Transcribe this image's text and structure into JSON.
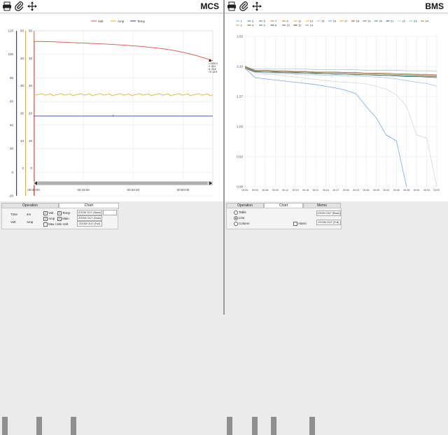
{
  "mcs": {
    "title": "MCS",
    "chart": {
      "legend": [
        {
          "name": "Volt",
          "color": "#d9534f"
        },
        {
          "name": "Amp",
          "color": "#e6b422"
        },
        {
          "name": "Temp",
          "color": "#3a3aa8"
        }
      ],
      "axis_volt": [
        "120",
        "100",
        "80",
        "60",
        "40",
        "20",
        "0",
        "-20"
      ],
      "axis_amp": [
        "50",
        "40",
        "30",
        "20",
        "10",
        "0"
      ],
      "axis_temp": [
        "50",
        "40",
        "30",
        "20",
        "10",
        "0"
      ],
      "x_ticks": [
        "00:00:00",
        "00:16:40",
        "00:33:20",
        "00:50:00"
      ],
      "tooltip": [
        "1:0:0/0:0",
        "V: 93.0",
        "A: 23.8",
        "T0: 18.9"
      ],
      "series": {
        "volt": [
          [
            0,
            111
          ],
          [
            300,
            110.8
          ],
          [
            600,
            110.3
          ],
          [
            900,
            109.7
          ],
          [
            1200,
            109.2
          ],
          [
            1500,
            108.6
          ],
          [
            1800,
            107.9
          ],
          [
            2100,
            107
          ],
          [
            2400,
            105.7
          ],
          [
            2700,
            104.2
          ],
          [
            3000,
            101.8
          ],
          [
            3300,
            98.6
          ],
          [
            3600,
            94.6
          ]
        ],
        "amp": [
          [
            0,
            26.8
          ],
          [
            3600,
            26.8
          ]
        ],
        "temp": [
          [
            0,
            19
          ],
          [
            3600,
            19
          ]
        ]
      }
    },
    "tabs": [
      "Operation",
      "Chart"
    ],
    "controls": {
      "time_label": "Time",
      "time_value": "4m",
      "volt_label": "Volt",
      "amp_label": "Amp",
      "cb_volt": "Volt",
      "cb_amp": "Amp",
      "cb_minmax": "Max / Min Volt",
      "cb_temp": "Temp",
      "cb_main": "Main",
      "btn_zoom_back": "ZOOM OUT (Back)",
      "btn_zoom_data": "ZOOM OUT (Data)",
      "btn_zoom_full": "ZOOM OUT (Full)"
    }
  },
  "bms": {
    "title": "BMS",
    "chart": {
      "y_ticks": [
        "2.62",
        "2.10",
        "1.57",
        "1.05",
        "0.52",
        "0.00"
      ],
      "x_ticks": [
        "00:00",
        "00:03",
        "00:06",
        "00:09",
        "00:12",
        "00:15",
        "00:18",
        "00:21",
        "00:24",
        "00:27",
        "00:30",
        "00:33",
        "00:36",
        "00:39",
        "00:42",
        "00:45",
        "00:48",
        "00:51",
        "00:54",
        "00:57"
      ],
      "legend": [
        {
          "name": "1",
          "color": "#7fb3d5"
        },
        {
          "name": "2",
          "color": "#e59866"
        },
        {
          "name": "3",
          "color": "#2e86c1"
        },
        {
          "name": "4",
          "color": "#a04000"
        },
        {
          "name": "5",
          "color": "#5d6d7e"
        },
        {
          "name": "6",
          "color": "#138d75"
        },
        {
          "name": "7",
          "color": "#ca6f1e"
        },
        {
          "name": "8",
          "color": "#1b4f72"
        },
        {
          "name": "9",
          "color": "#b9770e"
        },
        {
          "name": "10",
          "color": "#7d3c98"
        },
        {
          "name": "11",
          "color": "#d4ac0d"
        },
        {
          "name": "12",
          "color": "#6e2c00"
        },
        {
          "name": "13",
          "color": "#f1c40f"
        },
        {
          "name": "14",
          "color": "#85929e"
        },
        {
          "name": "15",
          "color": "#aab7b8"
        },
        {
          "name": "16",
          "color": "#5dade2"
        },
        {
          "name": "17",
          "color": "#f39c12"
        },
        {
          "name": "18",
          "color": "#c0392b"
        },
        {
          "name": "19",
          "color": "#566573"
        },
        {
          "name": "20",
          "color": "#229954"
        },
        {
          "name": "21",
          "color": "#1f618d"
        },
        {
          "name": "22",
          "color": "#a3e4d7"
        },
        {
          "name": "23",
          "color": "#76d7c4"
        },
        {
          "name": "24",
          "color": "#dc7633"
        }
      ],
      "cells": [
        {
          "color": "#9fc5e8",
          "v": [
            [
              0,
              2.07
            ],
            [
              3,
              2.0
            ],
            [
              6,
              1.98
            ],
            [
              9,
              1.97
            ],
            [
              12,
              1.97
            ],
            [
              15,
              1.96
            ],
            [
              18,
              1.95
            ],
            [
              21,
              1.95
            ],
            [
              24,
              1.94
            ],
            [
              27,
              1.94
            ],
            [
              30,
              1.93
            ],
            [
              33,
              1.93
            ],
            [
              36,
              1.92
            ],
            [
              39,
              1.91
            ],
            [
              42,
              1.9
            ],
            [
              45,
              1.88
            ],
            [
              48,
              1.85
            ],
            [
              51,
              1.82
            ],
            [
              54,
              1.8
            ],
            [
              57,
              1.75
            ]
          ]
        },
        {
          "color": "#7fa9d6",
          "v": [
            [
              0,
              2.07
            ],
            [
              3,
              1.9
            ],
            [
              6,
              1.88
            ],
            [
              9,
              1.86
            ],
            [
              12,
              1.84
            ],
            [
              15,
              1.82
            ],
            [
              18,
              1.8
            ],
            [
              21,
              1.78
            ],
            [
              24,
              1.75
            ],
            [
              27,
              1.72
            ],
            [
              30,
              1.68
            ],
            [
              33,
              1.62
            ],
            [
              36,
              1.4
            ],
            [
              39,
              1.2
            ],
            [
              42,
              0.9
            ],
            [
              45,
              0.8
            ],
            [
              48,
              0.0
            ]
          ]
        },
        {
          "color": "#d7d7d7",
          "v": [
            [
              0,
              2.07
            ],
            [
              3,
              1.98
            ],
            [
              6,
              1.96
            ],
            [
              9,
              1.95
            ],
            [
              12,
              1.93
            ],
            [
              15,
              1.91
            ],
            [
              18,
              1.89
            ],
            [
              21,
              1.87
            ],
            [
              24,
              1.85
            ],
            [
              27,
              1.83
            ],
            [
              30,
              1.82
            ],
            [
              33,
              1.81
            ],
            [
              36,
              1.79
            ],
            [
              39,
              1.75
            ],
            [
              42,
              1.7
            ],
            [
              45,
              1.6
            ],
            [
              48,
              1.4
            ],
            [
              51,
              0.9
            ],
            [
              54,
              0.85
            ],
            [
              57,
              0.0
            ]
          ]
        },
        {
          "color": "#bdbdbd",
          "v": [
            [
              0,
              2.07
            ],
            [
              3,
              2.03
            ],
            [
              6,
              2.03
            ],
            [
              9,
              2.02
            ],
            [
              12,
              2.02
            ],
            [
              15,
              2.01
            ],
            [
              18,
              2.01
            ],
            [
              21,
              2.0
            ],
            [
              24,
              2.0
            ],
            [
              27,
              2.0
            ],
            [
              30,
              1.99
            ],
            [
              33,
              1.99
            ],
            [
              36,
              1.98
            ],
            [
              39,
              1.98
            ],
            [
              42,
              1.97
            ],
            [
              45,
              1.97
            ],
            [
              48,
              1.96
            ],
            [
              51,
              1.95
            ],
            [
              54,
              1.95
            ],
            [
              57,
              1.94
            ]
          ]
        },
        {
          "color": "#a3c4e8",
          "v": [
            [
              0,
              2.08
            ],
            [
              3,
              2.05
            ],
            [
              6,
              2.05
            ],
            [
              9,
              2.05
            ],
            [
              12,
              2.05
            ],
            [
              15,
              2.05
            ],
            [
              18,
              2.05
            ],
            [
              21,
              2.04
            ],
            [
              24,
              2.04
            ],
            [
              27,
              2.04
            ],
            [
              30,
              2.04
            ],
            [
              33,
              2.04
            ],
            [
              36,
              2.03
            ],
            [
              39,
              2.03
            ],
            [
              42,
              2.03
            ],
            [
              45,
              2.03
            ],
            [
              48,
              2.02
            ],
            [
              51,
              2.02
            ],
            [
              54,
              2.02
            ],
            [
              57,
              2.01
            ]
          ]
        },
        {
          "color": "#8a6d3b",
          "v": [
            [
              0,
              2.09
            ],
            [
              3,
              2.02
            ],
            [
              6,
              2.02
            ],
            [
              9,
              2.01
            ],
            [
              12,
              2.01
            ],
            [
              15,
              2.0
            ],
            [
              18,
              2.0
            ],
            [
              21,
              1.99
            ],
            [
              24,
              1.99
            ],
            [
              27,
              1.99
            ],
            [
              30,
              1.98
            ],
            [
              33,
              1.98
            ],
            [
              36,
              1.97
            ],
            [
              39,
              1.97
            ],
            [
              42,
              1.96
            ],
            [
              45,
              1.96
            ],
            [
              48,
              1.95
            ],
            [
              51,
              1.95
            ],
            [
              54,
              1.94
            ],
            [
              57,
              1.94
            ]
          ]
        },
        {
          "color": "#3f8f6e",
          "v": [
            [
              0,
              2.08
            ],
            [
              3,
              2.01
            ],
            [
              6,
              2.0
            ],
            [
              9,
              2.0
            ],
            [
              12,
              1.99
            ],
            [
              15,
              1.99
            ],
            [
              18,
              1.98
            ],
            [
              21,
              1.98
            ],
            [
              24,
              1.97
            ],
            [
              27,
              1.97
            ],
            [
              30,
              1.96
            ],
            [
              33,
              1.96
            ],
            [
              36,
              1.95
            ],
            [
              39,
              1.95
            ],
            [
              42,
              1.94
            ],
            [
              45,
              1.94
            ],
            [
              48,
              1.93
            ],
            [
              51,
              1.93
            ],
            [
              54,
              1.92
            ],
            [
              57,
              1.92
            ]
          ]
        },
        {
          "color": "#c49a5a",
          "v": [
            [
              0,
              2.1
            ],
            [
              3,
              2.03
            ],
            [
              6,
              2.03
            ],
            [
              9,
              2.02
            ],
            [
              12,
              2.02
            ],
            [
              15,
              2.01
            ],
            [
              18,
              2.01
            ],
            [
              21,
              2.0
            ],
            [
              24,
              2.0
            ],
            [
              27,
              2.0
            ],
            [
              30,
              1.99
            ],
            [
              33,
              1.99
            ],
            [
              36,
              1.98
            ],
            [
              39,
              1.98
            ],
            [
              42,
              1.98
            ],
            [
              45,
              1.97
            ],
            [
              48,
              1.97
            ],
            [
              51,
              1.96
            ],
            [
              54,
              1.96
            ],
            [
              57,
              1.95
            ]
          ]
        },
        {
          "color": "#6b6b6b",
          "v": [
            [
              0,
              2.06
            ],
            [
              3,
              2.0
            ],
            [
              6,
              2.0
            ],
            [
              9,
              1.99
            ],
            [
              12,
              1.99
            ],
            [
              15,
              1.98
            ],
            [
              18,
              1.98
            ],
            [
              21,
              1.97
            ],
            [
              24,
              1.97
            ],
            [
              27,
              1.96
            ],
            [
              30,
              1.96
            ],
            [
              33,
              1.95
            ],
            [
              36,
              1.95
            ],
            [
              39,
              1.94
            ],
            [
              42,
              1.94
            ],
            [
              45,
              1.93
            ],
            [
              48,
              1.92
            ],
            [
              51,
              1.92
            ],
            [
              54,
              1.91
            ],
            [
              57,
              1.9
            ]
          ]
        }
      ]
    },
    "tabs": [
      "Operation",
      "Chart",
      "Memo"
    ],
    "controls": {
      "rd_table": "Table",
      "rd_line": "Line",
      "rd_column": "Column",
      "cb_alarm": "Alarm",
      "btn_zoom_back": "ZOOM OUT (Back)",
      "btn_zoom_full": "ZOOM OUT (Full)"
    }
  }
}
